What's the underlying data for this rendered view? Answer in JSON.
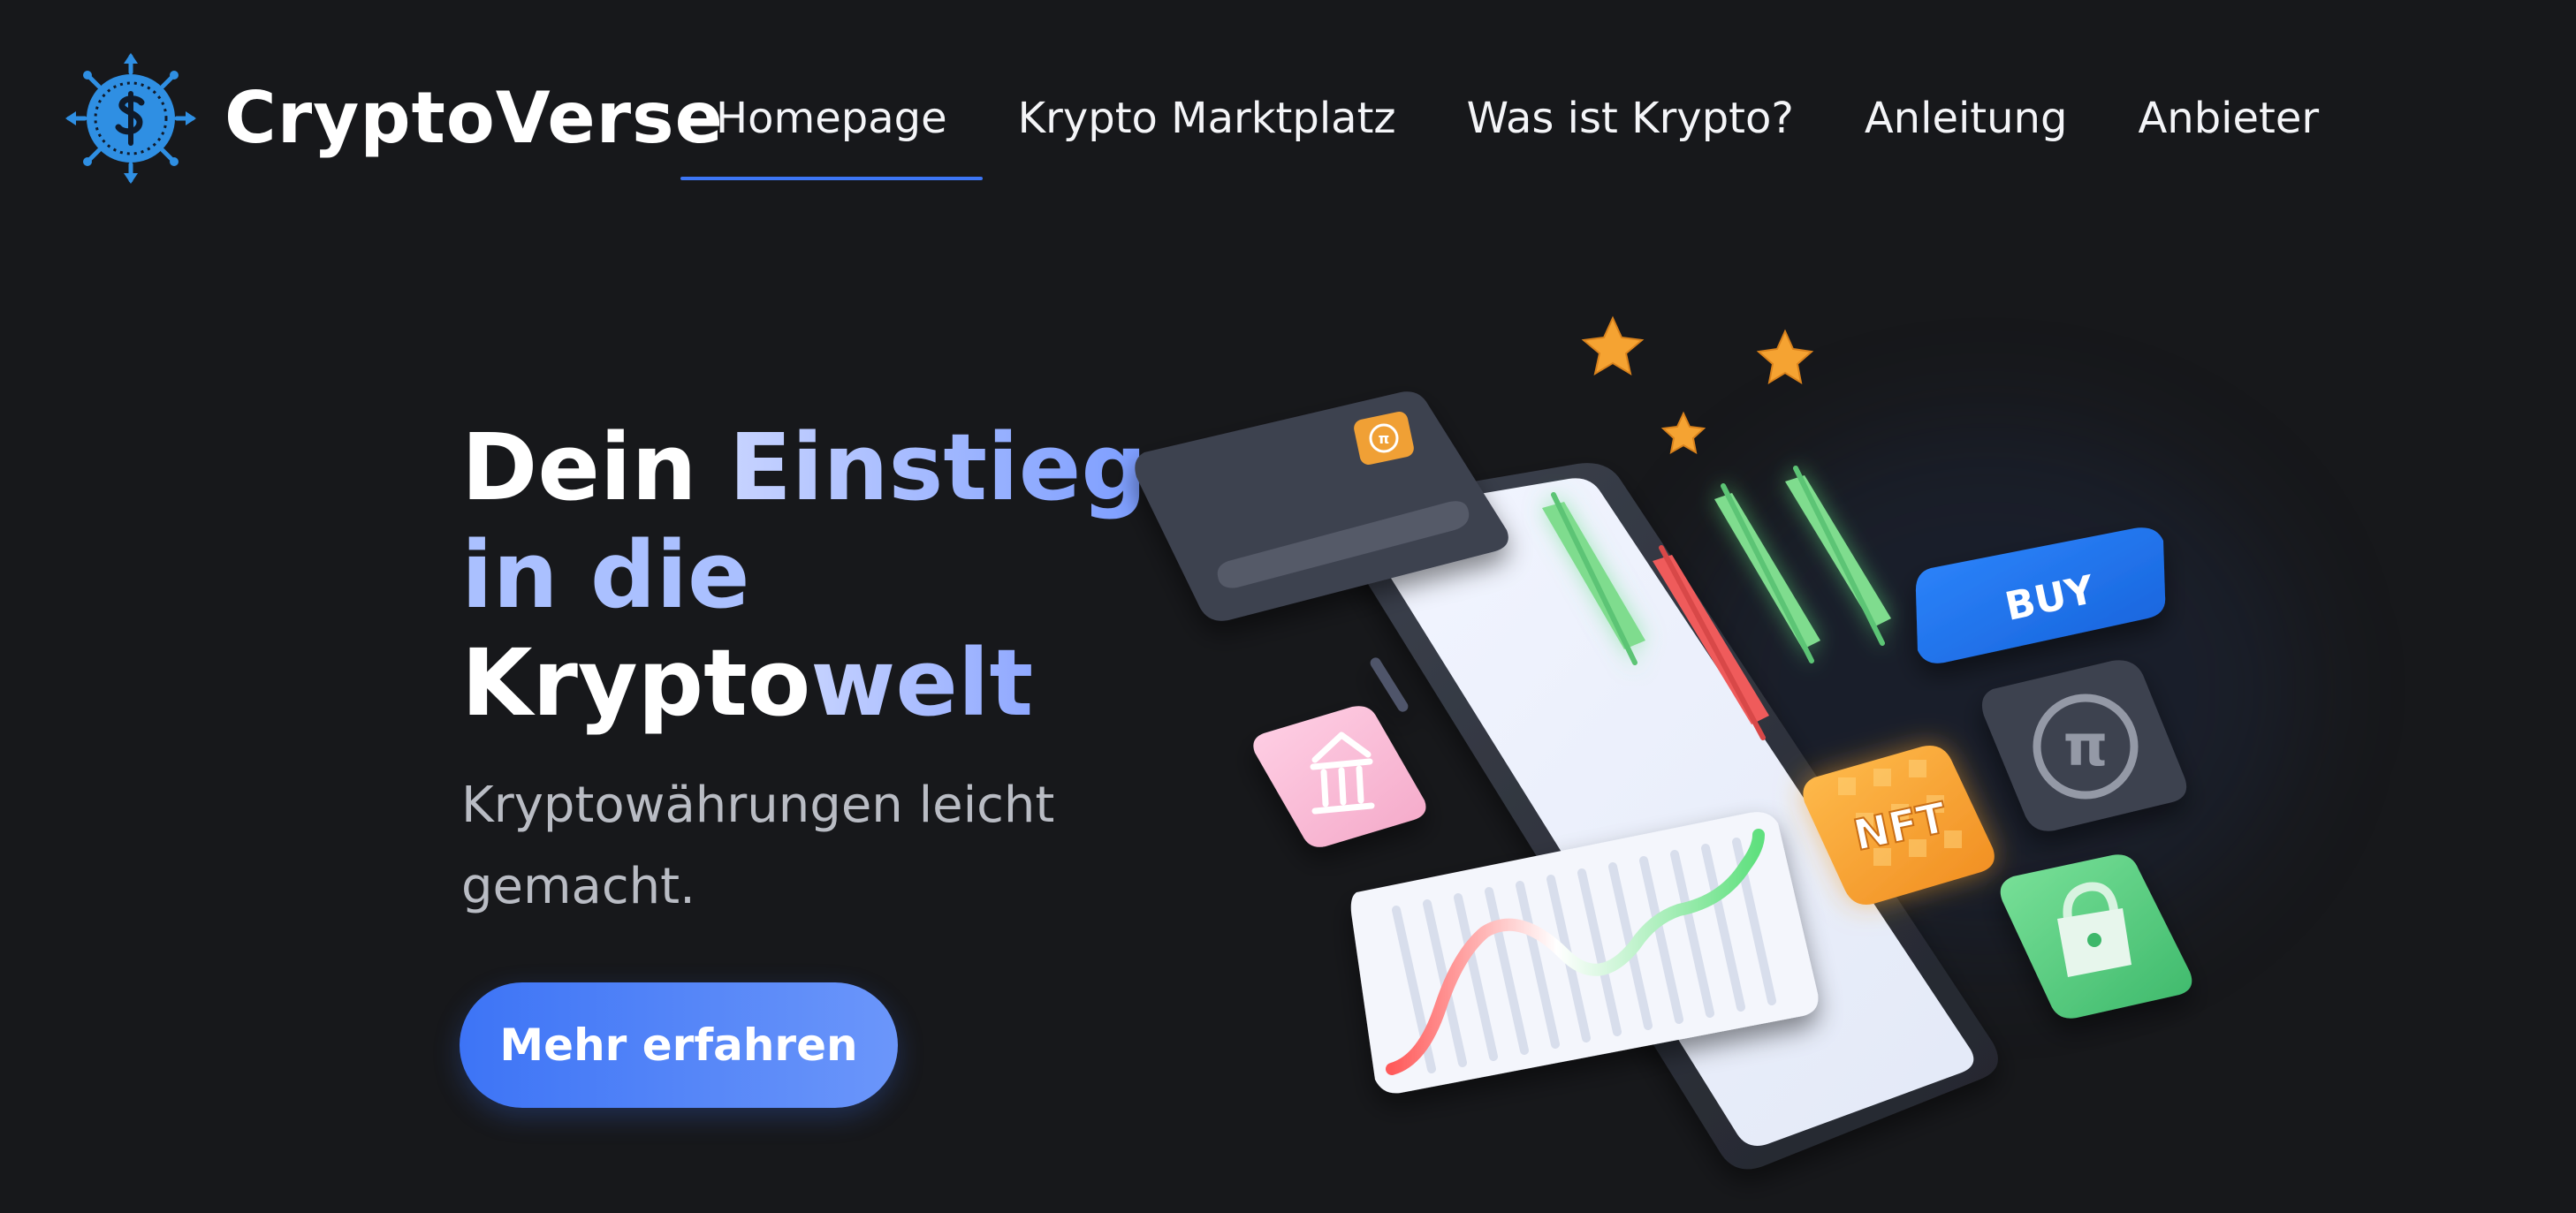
{
  "header": {
    "brand": "CryptoVerse",
    "logo_icon": "dollar-coin-icon",
    "nav": [
      {
        "label": "Homepage",
        "active": true
      },
      {
        "label": "Krypto Marktplatz",
        "active": false
      },
      {
        "label": "Was ist Krypto?",
        "active": false
      },
      {
        "label": "Anleitung",
        "active": false
      },
      {
        "label": "Anbieter",
        "active": false
      }
    ]
  },
  "hero": {
    "title_word_1": "Dein",
    "title_word_2": "Einstieg",
    "title_word_3": "in die",
    "title_word_4": "Krypto",
    "title_word_5": "welt",
    "subtitle": "Kryptowährungen leicht gemacht.",
    "cta_label": "Mehr erfahren"
  },
  "illustration": {
    "buy_label": "BUY",
    "nft_label": "NFT",
    "icons": [
      "credit-card-icon",
      "pi-coin-icon",
      "bank-icon",
      "lock-icon",
      "star-icon"
    ]
  },
  "colors": {
    "background": "#17181b",
    "accent": "#3d76f5",
    "buy_blue": "#1f6ef0",
    "candle_green": "#68d67f",
    "candle_red": "#ee5b5b",
    "nft_orange": "#f5a332",
    "card_gray": "#3e4250"
  }
}
